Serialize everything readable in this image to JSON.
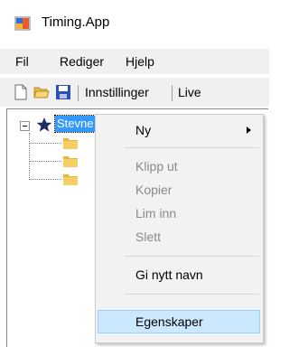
{
  "window": {
    "title": "Timing.App"
  },
  "menubar": {
    "items": [
      "Fil",
      "Rediger",
      "Hjelp"
    ]
  },
  "toolbar": {
    "new_icon": "new-file-icon",
    "open_icon": "open-folder-icon",
    "save_icon": "save-floppy-icon",
    "settings_label": "Innstillinger",
    "live_label": "Live"
  },
  "tree": {
    "root_label": "Stevne",
    "root_icon": "star-icon",
    "child_icon": "folder-icon"
  },
  "context_menu": {
    "items": [
      {
        "label": "Ny",
        "enabled": true,
        "has_submenu": true
      },
      {
        "label": "Klipp ut",
        "enabled": false
      },
      {
        "label": "Kopier",
        "enabled": false
      },
      {
        "label": "Lim inn",
        "enabled": false
      },
      {
        "label": "Slett",
        "enabled": false
      },
      {
        "label": "Gi nytt navn",
        "enabled": true
      },
      {
        "label": "Egenskaper",
        "enabled": true,
        "highlighted": true
      }
    ]
  },
  "colors": {
    "selection": "#3399ff",
    "menu_background": "#f2f2f2",
    "menu_hover": "#cce8ff",
    "disabled_text": "#8a8a8a",
    "bar_background": "#f0f0f0"
  }
}
